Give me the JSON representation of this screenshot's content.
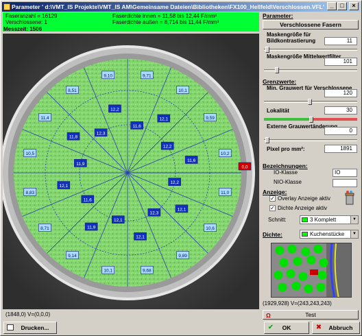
{
  "window": {
    "title": "Parameter ' d:\\VMT_IS Projekte\\VMT_IS AM\\Gemeinsame Dateien\\Bibliotheken\\FX100_Hellfeld\\Verschlossen.VFL'",
    "minimize": "_",
    "maximize": "□",
    "close": "×"
  },
  "info": {
    "faseranzahl": "Faseranzahl = 16129",
    "verschlossene": "Verschlossene: 1",
    "dichte_innen": "Faserdichte innen = 11,58 bis 12,44 F/mm²",
    "dichte_aussen": "Faserdichte außen = 8,714 bis 11,44 F/mm²",
    "messzeit": "Messzeit: 1506"
  },
  "image": {
    "outer_labels": [
      "9,71",
      "10,1",
      "9,10",
      "9,59",
      "8,51",
      "10,2",
      "11,4",
      "11,0",
      "10,5",
      "10,6",
      "8,83",
      "9,89",
      "8,71",
      "9,68",
      "9,14",
      "10,1"
    ],
    "inner_labels": [
      "11,6",
      "12,1",
      "12,2",
      "11,6",
      "12,2",
      "12,1",
      "12,3",
      "12,1",
      "12,1",
      "11,9",
      "11,6",
      "12,1",
      "11,9",
      "11,8",
      "12,3",
      "12,2"
    ],
    "alert_label": "0,0"
  },
  "status": {
    "coords": "(1848,0)  V=(0,0,0)",
    "preview_coords": "(1929,928)  V=(243,243,243)"
  },
  "buttons": {
    "print": "Drucken...",
    "ok": "OK",
    "cancel": "Abbruch",
    "test": "Test"
  },
  "panel": {
    "parameter_title": "Parameter:",
    "tab_label": "Verschlossene Fasern",
    "maske_kontrast_label": "Maskengröße für Bildkontrastierung",
    "maske_kontrast_value": "11",
    "maske_mittel_label": "Maskengröße Mittelwertfilter",
    "maske_mittel_value": "101",
    "grenzwerte_title": "Grenzwerte:",
    "min_grauwert_label": "Min. Grauwert für Verschlossene",
    "min_grauwert_value": "120",
    "lokalitaet_label": "Lokalität",
    "lokalitaet_value": "30",
    "externe_label": "Externe Grauwertänderung",
    "externe_value": "0",
    "pixel_label": "Pixel pro mm²:",
    "pixel_value": "1891",
    "bezeichnungen_title": "Bezeichnungen:",
    "io_label": "IO-Klasse",
    "io_value": "IO",
    "nio_label": "NIO-Klasse",
    "nio_value": "",
    "anzeige_title": "Anzeige:",
    "overlay_label": "Overlay Anzeige aktiv",
    "dichte_anzeige_label": "Dichte Anzeige aktiv",
    "schnitt_label": "Schnitt:",
    "schnitt_value": "3 Komplett",
    "dichte_title": "Dichte:",
    "dichte_value": "Kuchenstücke"
  },
  "colors": {
    "info_bg": "#00ff33",
    "overlay_green": "#7edc6c",
    "alert_red": "#cc0000"
  }
}
